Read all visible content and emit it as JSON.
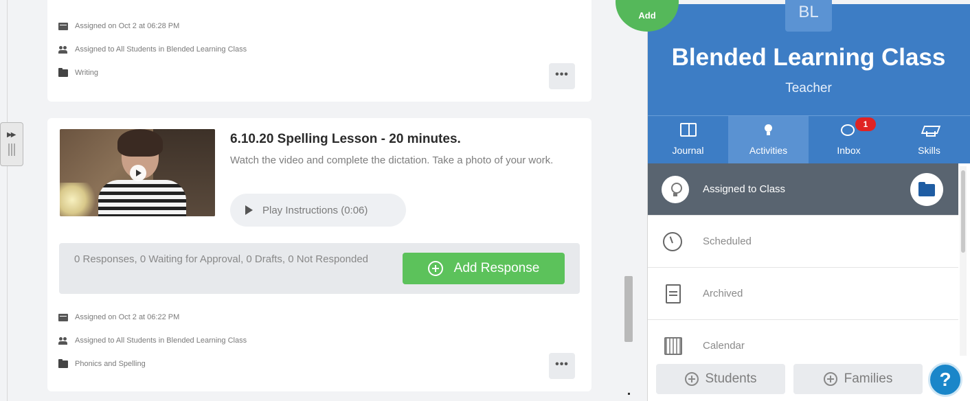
{
  "feed": {
    "top_card": {
      "assigned_on": "Assigned on Oct 2 at 06:28 PM",
      "assigned_to": "Assigned to All Students in Blended Learning Class",
      "folder": "Writing",
      "more_label": "•••"
    },
    "lesson_card": {
      "title": "6.10.20 Spelling Lesson - 20 minutes.",
      "description": "Watch the video and complete the dictation. Take a photo of your work.",
      "play_instructions": "Play Instructions (0:06)",
      "responses_summary": "0 Responses, 0 Waiting for Approval, 0 Drafts, 0 Not Responded",
      "add_response_label": "Add Response",
      "assigned_on": "Assigned on Oct 2 at 06:22 PM",
      "assigned_to": "Assigned to All Students in Blended Learning Class",
      "folder": "Phonics and Spelling",
      "more_label": "•••"
    },
    "add_button_label": "Add"
  },
  "panel": {
    "avatar_initials": "BL",
    "class_name": "Blended Learning Class",
    "role": "Teacher",
    "tabs": [
      {
        "label": "Journal",
        "icon": "book-icon"
      },
      {
        "label": "Activities",
        "icon": "lightbulb-icon",
        "active": true
      },
      {
        "label": "Inbox",
        "icon": "chat-icon",
        "badge": "1"
      },
      {
        "label": "Skills",
        "icon": "graduation-cap-icon"
      }
    ],
    "list": [
      {
        "label": "Assigned to Class",
        "icon": "lightbulb-icon",
        "active": true
      },
      {
        "label": "Scheduled",
        "icon": "clock-icon"
      },
      {
        "label": "Archived",
        "icon": "document-icon"
      },
      {
        "label": "Calendar",
        "icon": "calendar-icon"
      }
    ],
    "footer": {
      "students_label": "Students",
      "families_label": "Families"
    }
  },
  "colors": {
    "header_blue": "#3d7dc5",
    "active_tab": "#5a92d2",
    "active_item": "#596470",
    "green": "#5cc25b",
    "badge_red": "#e02323"
  }
}
